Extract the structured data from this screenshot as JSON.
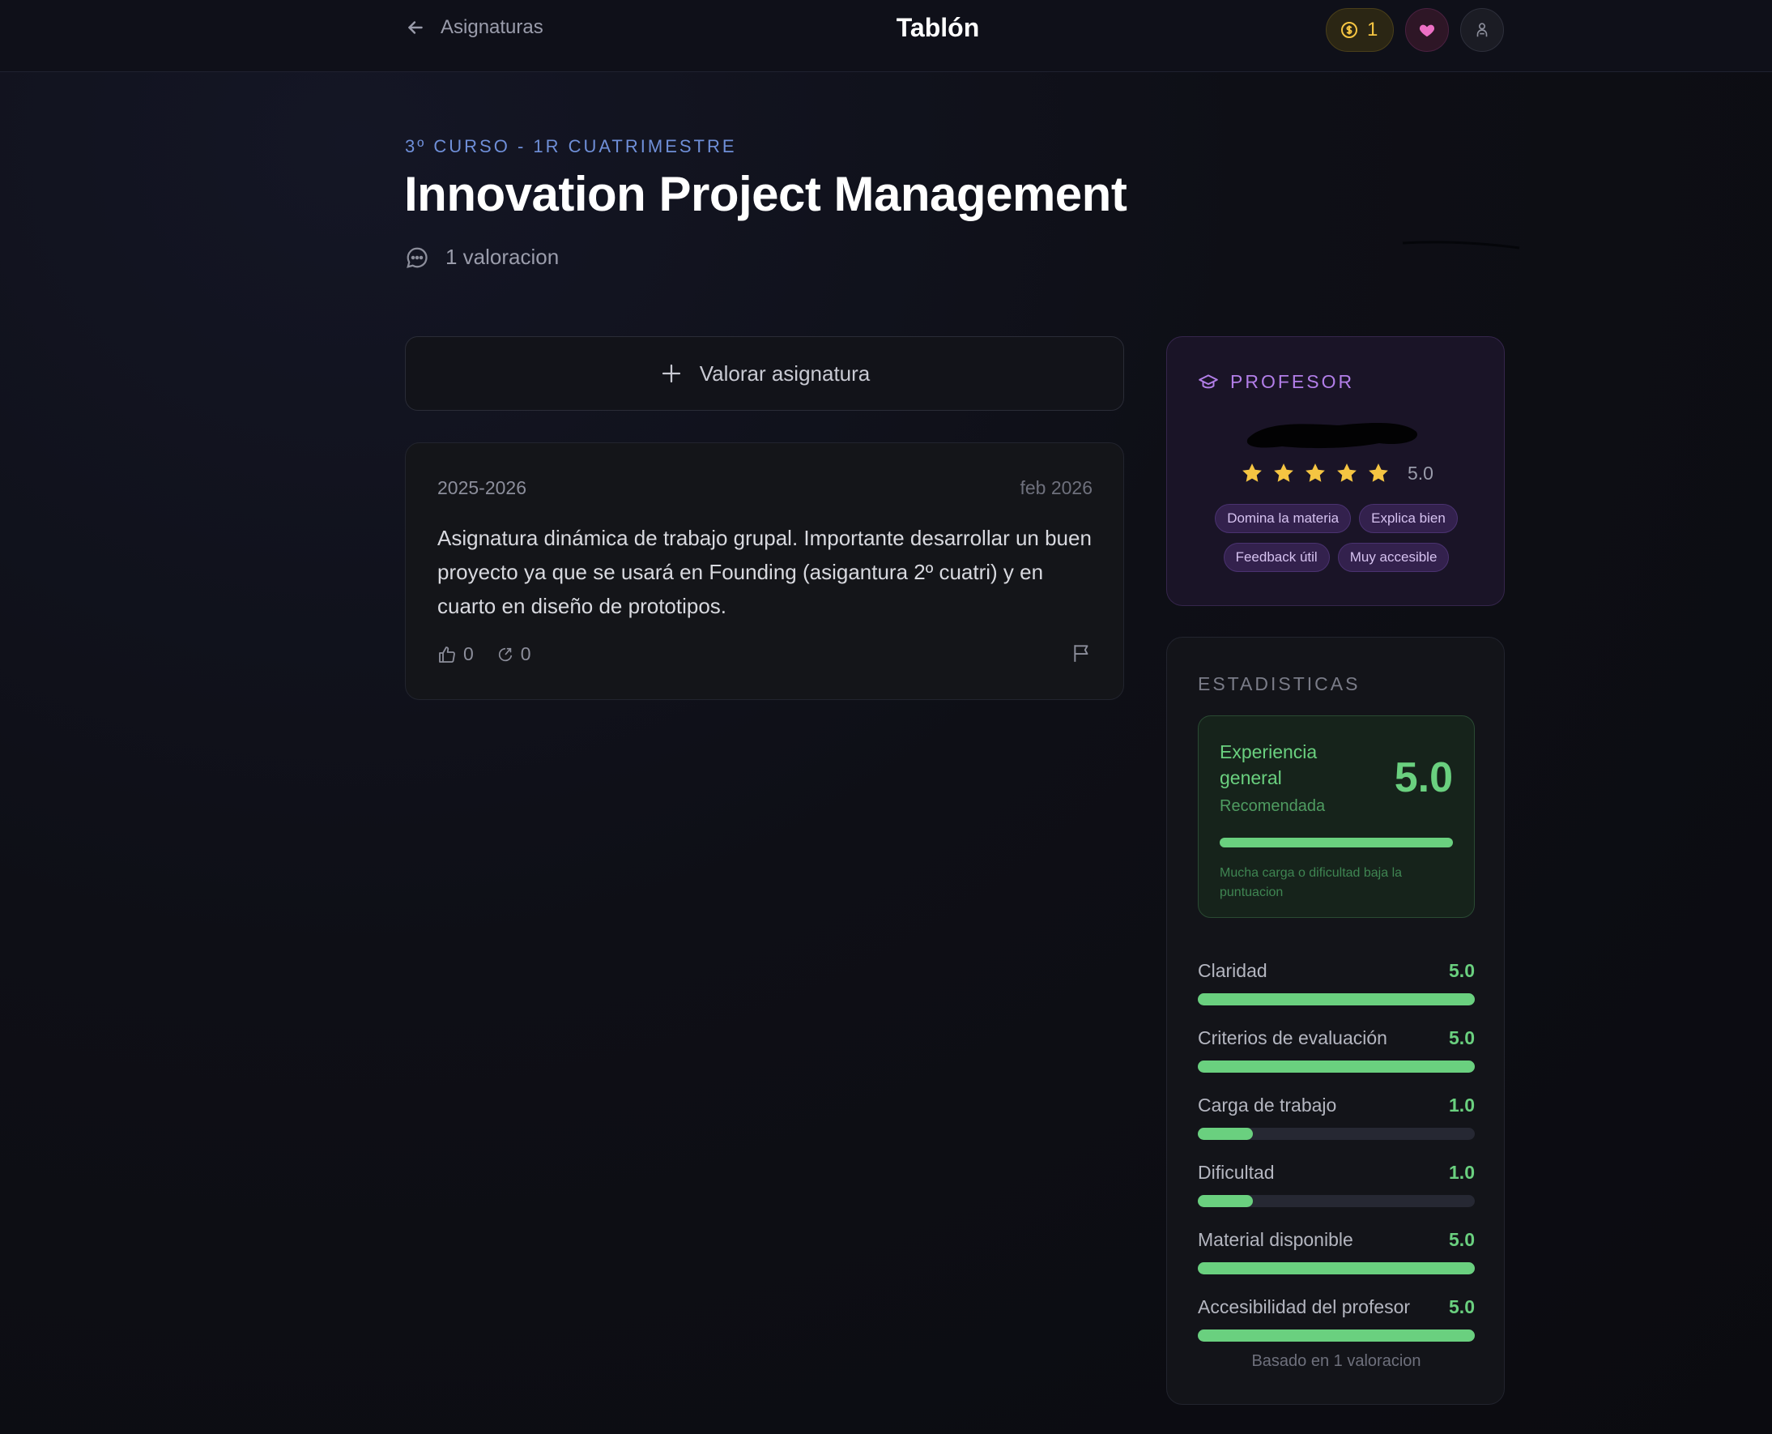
{
  "header": {
    "back_label": "Asignaturas",
    "title": "Tablón",
    "coins": "1"
  },
  "course": {
    "subtitle": "3º CURSO - 1R CUATRIMESTRE",
    "name": "Innovation Project Management",
    "rating_count": "1 valoracion"
  },
  "rate_button": {
    "label": "Valorar asignatura"
  },
  "review": {
    "year": "2025-2026",
    "date": "feb 2026",
    "text": "Asignatura dinámica de trabajo grupal. Importante desarrollar un buen proyecto ya que se usará en Founding (asigantura 2º cuatri) y en cuarto en diseño de prototipos.",
    "likes": "0",
    "dislikes": "0"
  },
  "professor": {
    "label": "PROFESOR",
    "stars": 5,
    "score": "5.0",
    "tags": [
      "Domina la materia",
      "Explica bien",
      "Feedback útil",
      "Muy accesible"
    ]
  },
  "stats": {
    "heading": "ESTADISTICAS",
    "experience": {
      "label": "Experiencia general",
      "recommendation": "Recomendada",
      "score": "5.0",
      "level": 1.0,
      "note": "Mucha carga o dificultad baja la puntuacion"
    },
    "metrics": [
      {
        "name": "Claridad",
        "value": "5.0",
        "level": 1.0
      },
      {
        "name": "Criterios de evaluación",
        "value": "5.0",
        "level": 1.0
      },
      {
        "name": "Carga de trabajo",
        "value": "1.0",
        "level": 0.2
      },
      {
        "name": "Dificultad",
        "value": "1.0",
        "level": 0.2
      },
      {
        "name": "Material disponible",
        "value": "5.0",
        "level": 1.0
      },
      {
        "name": "Accesibilidad del profesor",
        "value": "5.0",
        "level": 1.0
      }
    ],
    "footer": "Basado en 1 valoracion"
  },
  "colors": {
    "accent_blue": "#6f8fd8",
    "accent_purple": "#b27ee8",
    "accent_green": "#6ad07f",
    "star_yellow": "#f5c542"
  }
}
